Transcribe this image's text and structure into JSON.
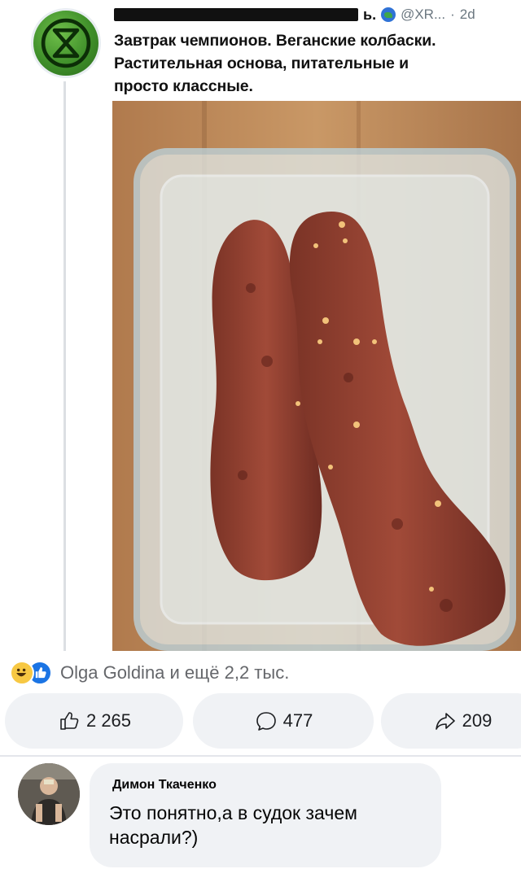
{
  "post": {
    "handle": "@XR...",
    "separator": "·",
    "age": "2d",
    "name_tail": "ь.",
    "text_lines": [
      "Завтрак чемпионов. Веганские колбаски.",
      "Растительная основа, питательные и",
      "просто классные."
    ],
    "avatar_icon": "extinction-rebellion-logo-icon",
    "photo_subject": "vegan-sausages-in-glass-container-icon"
  },
  "reactions": {
    "icons": [
      "haha-reaction-icon",
      "like-reaction-icon"
    ],
    "summary": "Olga Goldina и ещё 2,2 тыс."
  },
  "actions": {
    "like_count": "2 265",
    "comment_count": "477",
    "share_count": "209"
  },
  "comment": {
    "author": "Димон Ткаченко",
    "text_lines": [
      "Это понятно,а в судок зачем",
      "насрали?)"
    ]
  },
  "colors": {
    "pill_bg": "#f0f2f5",
    "muted_text": "#65676b",
    "like_blue": "#1b74e4",
    "haha_yellow": "#f7c843"
  }
}
